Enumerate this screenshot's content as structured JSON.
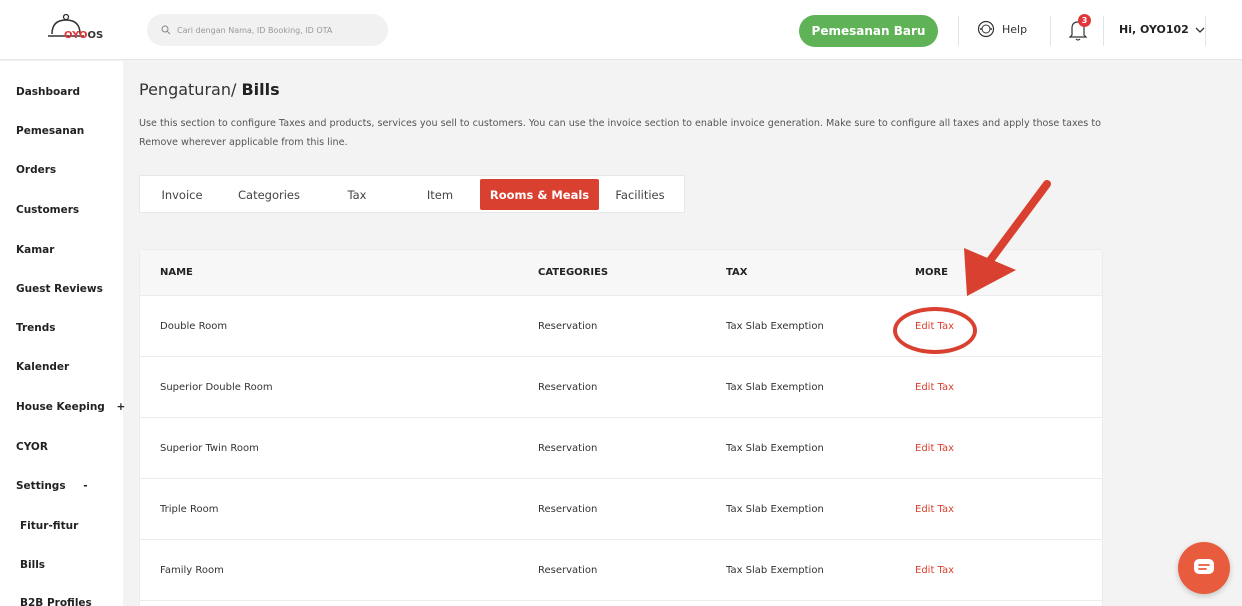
{
  "header": {
    "logo_brand": "OYO",
    "logo_suffix": "OS",
    "search_placeholder": "Cari dengan Nama, ID Booking, ID OTA",
    "new_booking_label": "Pemesanan Baru",
    "help_label": "Help",
    "notification_count": "3",
    "user_greeting": "Hi, OYO102"
  },
  "sidebar": {
    "items": [
      {
        "label": "Dashboard"
      },
      {
        "label": "Pemesanan"
      },
      {
        "label": "Orders"
      },
      {
        "label": "Customers"
      },
      {
        "label": "Kamar"
      },
      {
        "label": "Guest Reviews"
      },
      {
        "label": "Trends"
      },
      {
        "label": "Kalender"
      },
      {
        "label": "House Keeping",
        "toggle": "+"
      },
      {
        "label": "CYOR"
      },
      {
        "label": "Settings",
        "toggle": "-"
      },
      {
        "label": "Fitur-fitur"
      },
      {
        "label": "Bills"
      },
      {
        "label": "B2B Profiles"
      }
    ]
  },
  "page": {
    "breadcrumb_parent": "Pengaturan/",
    "breadcrumb_current": "Bills",
    "description": "Use this section to configure Taxes and products, services you sell to customers. You can use the invoice section to enable invoice generation. Make sure to configure all taxes and apply those taxes to Remove wherever applicable from this line."
  },
  "tabs": [
    {
      "label": "Invoice"
    },
    {
      "label": "Categories"
    },
    {
      "label": "Tax"
    },
    {
      "label": "Item"
    },
    {
      "label": "Rooms & Meals",
      "active": true
    },
    {
      "label": "Facilities"
    }
  ],
  "table": {
    "headers": [
      "NAME",
      "CATEGORIES",
      "TAX",
      "MORE"
    ],
    "rows": [
      {
        "name": "Double Room",
        "category": "Reservation",
        "tax": "Tax Slab Exemption",
        "action": "Edit Tax"
      },
      {
        "name": "Superior Double Room",
        "category": "Reservation",
        "tax": "Tax Slab Exemption",
        "action": "Edit Tax"
      },
      {
        "name": "Superior Twin Room",
        "category": "Reservation",
        "tax": "Tax Slab Exemption",
        "action": "Edit Tax"
      },
      {
        "name": "Triple Room",
        "category": "Reservation",
        "tax": "Tax Slab Exemption",
        "action": "Edit Tax"
      },
      {
        "name": "Family Room",
        "category": "Reservation",
        "tax": "Tax Slab Exemption",
        "action": "Edit Tax"
      }
    ]
  },
  "colors": {
    "primary_green": "#5fb356",
    "accent_red": "#d9402f",
    "brand_red": "#e2373a"
  }
}
